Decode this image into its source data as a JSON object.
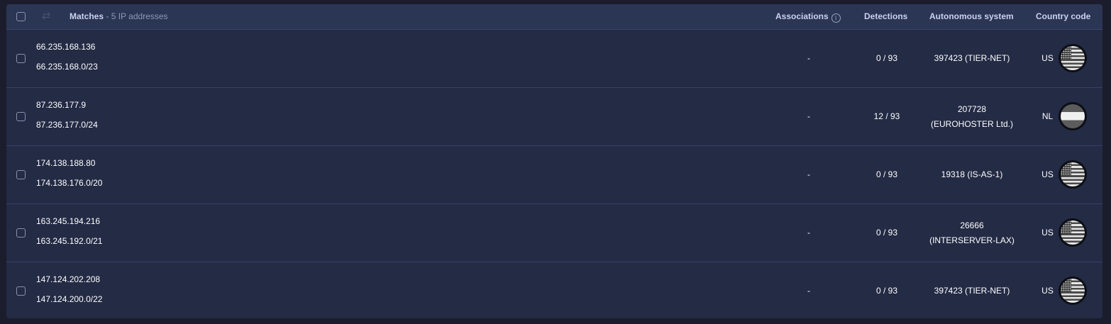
{
  "header": {
    "matches_label": "Matches",
    "matches_separator": " - ",
    "matches_count": "5 IP addresses",
    "columns": {
      "associations": "Associations",
      "detections": "Detections",
      "autonomous_system": "Autonomous system",
      "country_code": "Country code"
    }
  },
  "rows": [
    {
      "ip": "66.235.168.136",
      "network": "66.235.168.0/23",
      "associations": "-",
      "detections": "0 / 93",
      "as_line1": "397423 (TIER-NET)",
      "as_line2": "",
      "country": "US",
      "flag": "us-flag-icon"
    },
    {
      "ip": "87.236.177.9",
      "network": "87.236.177.0/24",
      "associations": "-",
      "detections": "12 / 93",
      "as_line1": "207728",
      "as_line2": "(EUROHOSTER Ltd.)",
      "country": "NL",
      "flag": "nl-flag-icon"
    },
    {
      "ip": "174.138.188.80",
      "network": "174.138.176.0/20",
      "associations": "-",
      "detections": "0 / 93",
      "as_line1": "19318 (IS-AS-1)",
      "as_line2": "",
      "country": "US",
      "flag": "us-flag-icon"
    },
    {
      "ip": "163.245.194.216",
      "network": "163.245.192.0/21",
      "associations": "-",
      "detections": "0 / 93",
      "as_line1": "26666",
      "as_line2": "(INTERSERVER-LAX)",
      "country": "US",
      "flag": "us-flag-icon"
    },
    {
      "ip": "147.124.202.208",
      "network": "147.124.200.0/22",
      "associations": "-",
      "detections": "0 / 93",
      "as_line1": "397423 (TIER-NET)",
      "as_line2": "",
      "country": "US",
      "flag": "us-flag-icon"
    }
  ]
}
